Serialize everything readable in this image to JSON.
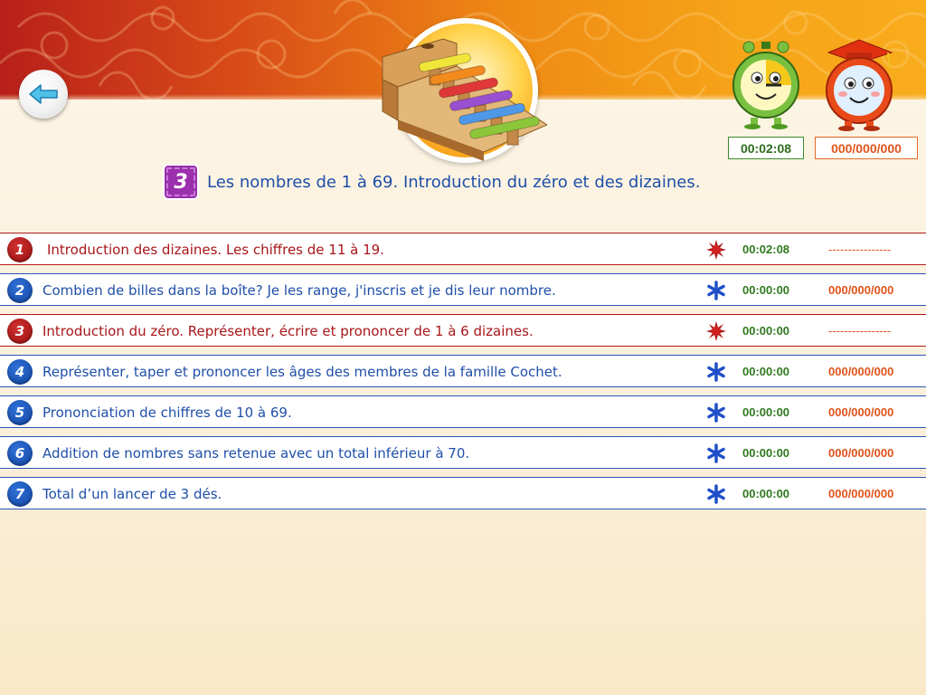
{
  "header": {
    "timer": "00:02:08",
    "score": "000/000/000"
  },
  "lesson": {
    "number": "3",
    "title": "Les nombres de 1 à 69. Introduction du zéro et des dizaines."
  },
  "exercises": [
    {
      "number": "1",
      "label": "Introduction des dizaines. Les chiffres de 11 à 19.",
      "status": "starburst",
      "color": "red",
      "time": "00:02:08",
      "score": "----------------"
    },
    {
      "number": "2",
      "label": "Combien de billes dans la boîte? Je les range, j'inscris et je dis leur nombre.",
      "status": "asterisk",
      "color": "blue",
      "time": "00:00:00",
      "score": "000/000/000"
    },
    {
      "number": "3",
      "label": "Introduction du zéro. Représenter, écrire et prononcer de 1 à 6 dizaines.",
      "status": "starburst",
      "color": "red",
      "time": "00:00:00",
      "score": "----------------"
    },
    {
      "number": "4",
      "label": "Représenter, taper et prononcer les âges des membres de la famille Cochet.",
      "status": "asterisk",
      "color": "blue",
      "time": "00:00:00",
      "score": "000/000/000"
    },
    {
      "number": "5",
      "label": "Prononciation de chiffres de 10 à 69.",
      "status": "asterisk",
      "color": "blue",
      "time": "00:00:00",
      "score": "000/000/000"
    },
    {
      "number": "6",
      "label": "Addition de nombres sans retenue avec un total inférieur à 70.",
      "status": "asterisk",
      "color": "blue",
      "time": "00:00:00",
      "score": "000/000/000"
    },
    {
      "number": "7",
      "label": "Total d’un lancer de 3 dés.",
      "status": "asterisk",
      "color": "blue",
      "time": "00:00:00",
      "score": "000/000/000"
    }
  ],
  "icons": {
    "back": "back-arrow-icon",
    "logo": "xylophone-stairs-icon",
    "clock": "clock-mascot-icon",
    "graduate": "graduate-clock-mascot-icon",
    "starburst": "starburst-icon",
    "asterisk": "asterisk-icon"
  },
  "colors": {
    "red": "#a8161a",
    "blue": "#1f4fa8",
    "green_time": "#2f7a1f",
    "orange_score": "#e0541c",
    "badge": "#9b2fae"
  }
}
